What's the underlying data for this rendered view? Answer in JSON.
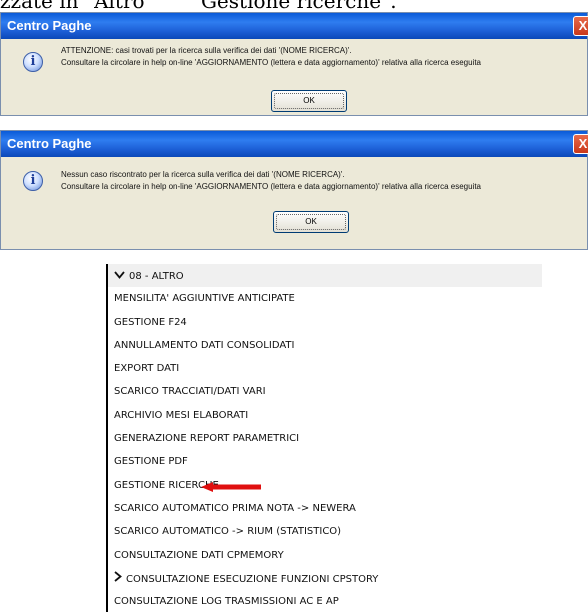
{
  "page_top_text": {
    "left": "zzate in \"Altro\"",
    "right": "\"Gestione ricerche\"."
  },
  "dialog1": {
    "title": "Centro Paghe",
    "close_label": "X",
    "icon": "info-icon",
    "line1": "ATTENZIONE: casi trovati per la ricerca sulla verifica dei dati '(NOME RICERCA)'.",
    "line2": "Consultare la circolare in help on-line 'AGGIORNAMENTO (lettera e data aggiornamento)' relativa alla ricerca eseguita",
    "ok_label": "OK"
  },
  "dialog2": {
    "title": "Centro Paghe",
    "close_label": "X",
    "icon": "info-icon",
    "line1": "Nessun caso riscontrato per la ricerca sulla verifica dei dati '(NOME RICERCA)'.",
    "line2": "Consultare la circolare in help on-line 'AGGIORNAMENTO (lettera e data aggiornamento)' relativa alla ricerca eseguita",
    "ok_label": "OK"
  },
  "menu": {
    "header": {
      "label": "08 - ALTRO",
      "icon": "chevron-down-icon"
    },
    "items": [
      {
        "label": "MENSILITA' AGGIUNTIVE ANTICIPATE"
      },
      {
        "label": "GESTIONE F24"
      },
      {
        "label": "ANNULLAMENTO DATI CONSOLIDATI"
      },
      {
        "label": "EXPORT DATI"
      },
      {
        "label": "SCARICO TRACCIATI/DATI VARI"
      },
      {
        "label": "ARCHIVIO MESI ELABORATI"
      },
      {
        "label": "GENERAZIONE REPORT PARAMETRICI"
      },
      {
        "label": "GESTIONE PDF"
      },
      {
        "label": "GESTIONE RICERCHE",
        "highlighted_by": "red-arrow-icon"
      },
      {
        "label": "SCARICO AUTOMATICO PRIMA NOTA -> NEWERA"
      },
      {
        "label": "SCARICO AUTOMATICO -> RIUM (STATISTICO)"
      },
      {
        "label": "CONSULTAZIONE DATI CPMEMORY"
      },
      {
        "label": "CONSULTAZIONE ESECUZIONE FUNZIONI CPSTORY",
        "icon": "chevron-right-icon"
      },
      {
        "label": "CONSULTAZIONE LOG TRASMISSIONI AC E AP"
      }
    ]
  },
  "colors": {
    "titlebar": "#1c5fd6",
    "dialog_bg": "#ece9d8",
    "close_button": "#c9381b",
    "arrow": "#e01010",
    "menu_header_bg": "#f0f0f0"
  }
}
